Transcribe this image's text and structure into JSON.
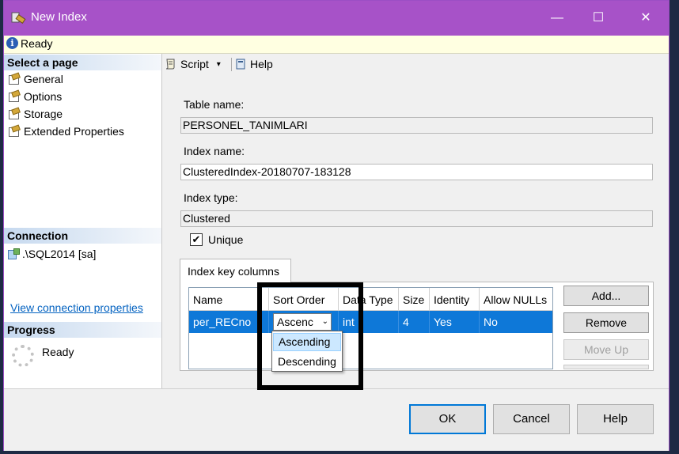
{
  "window": {
    "title": "New Index",
    "minimize": "—",
    "maximize": "☐",
    "close": "✕"
  },
  "status": {
    "text": "Ready",
    "icon": "info-icon"
  },
  "left_panel": {
    "select_page_header": "Select a page",
    "pages": [
      {
        "label": "General",
        "icon": "page-wrench-icon"
      },
      {
        "label": "Options",
        "icon": "page-wrench-icon"
      },
      {
        "label": "Storage",
        "icon": "page-wrench-icon"
      },
      {
        "label": "Extended Properties",
        "icon": "page-wrench-icon"
      }
    ],
    "connection_header": "Connection",
    "connection_value": ".\\SQL2014 [sa]",
    "connection_link": "View connection properties",
    "progress_header": "Progress",
    "progress_status": "Ready"
  },
  "toolbar": {
    "script_label": "Script",
    "script_arrow": "▾",
    "help_label": "Help"
  },
  "form": {
    "table_name_label": "Table name:",
    "table_name_value": "PERSONEL_TANIMLARI",
    "index_name_label": "Index name:",
    "index_name_value": "ClusteredIndex-20180707-183128",
    "index_type_label": "Index type:",
    "index_type_value": "Clustered",
    "unique_label": "Unique",
    "unique_checked": true
  },
  "tab": {
    "label": "Index key columns"
  },
  "grid": {
    "columns": [
      "Name",
      "Sort Order",
      "Data Type",
      "Size",
      "Identity",
      "Allow NULLs"
    ],
    "rows": [
      {
        "name": "per_RECno",
        "sort_order": "Ascenc",
        "data_type": "int",
        "size": "4",
        "identity": "Yes",
        "allow_nulls": "No"
      }
    ]
  },
  "side_buttons": {
    "add": "Add...",
    "remove": "Remove",
    "move_up": "Move Up"
  },
  "dropdown": {
    "options": [
      "Ascending",
      "Descending"
    ],
    "selected": "Ascending"
  },
  "dialog_buttons": {
    "ok": "OK",
    "cancel": "Cancel",
    "help": "Help"
  },
  "colors": {
    "titlebar": "#a752c8",
    "selection": "#0e78d8",
    "link": "#0563c1",
    "status_bg": "#ffffe1"
  }
}
